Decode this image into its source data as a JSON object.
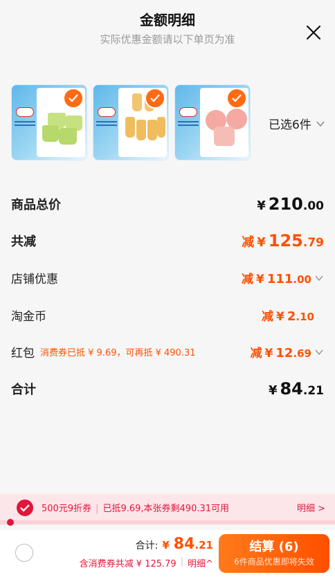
{
  "header": {
    "title": "金额明细",
    "subtitle": "实际优惠金额请以下单页为准"
  },
  "products": {
    "selected_summary": "已选6件",
    "items": [
      {
        "name": "product-1",
        "color": "#c7e28c"
      },
      {
        "name": "product-2",
        "color": "#f2c572"
      },
      {
        "name": "product-3",
        "color": "#f3a6a0"
      }
    ]
  },
  "summary": {
    "total_label": "商品总价",
    "total_yen": "¥",
    "total_int": "210",
    "total_dec": ".00",
    "reduce_label": "共减",
    "reduce_prefix": "减",
    "reduce_yen": "¥",
    "reduce_int": "125",
    "reduce_dec": ".79",
    "store_label": "店铺优惠",
    "store_prefix": "减",
    "store_yen": "¥",
    "store_int": "111",
    "store_dec": ".00",
    "coin_label": "淘金币",
    "coin_prefix": "减",
    "coin_yen": "¥",
    "coin_int": "2",
    "coin_dec": ".10",
    "redpack_label": "红包",
    "redpack_note": "消费券已抵 ¥ 9.69，可再抵 ¥ 490.31",
    "redpack_prefix": "减",
    "redpack_yen": "¥",
    "redpack_int": "12",
    "redpack_dec": ".69",
    "sum_label": "合计",
    "sum_yen": "¥",
    "sum_int": "84",
    "sum_dec": ".21"
  },
  "coupon_bar": {
    "name": "500元9折券",
    "status": "已抵9.69,本张券剩490.31可用",
    "detail": "明细 >"
  },
  "footer": {
    "total_label": "合计:",
    "total_yen": "¥",
    "total_int": "84",
    "total_dec": ".21",
    "reduce_text": "含消费券共减 ¥ 125.79",
    "detail_link": "明细^",
    "checkout_label": "结算 (6)",
    "checkout_sub": "6件商品优惠即将失效"
  },
  "colors": {
    "accent": "#ff5000",
    "coupon_red": "#e0173a"
  }
}
